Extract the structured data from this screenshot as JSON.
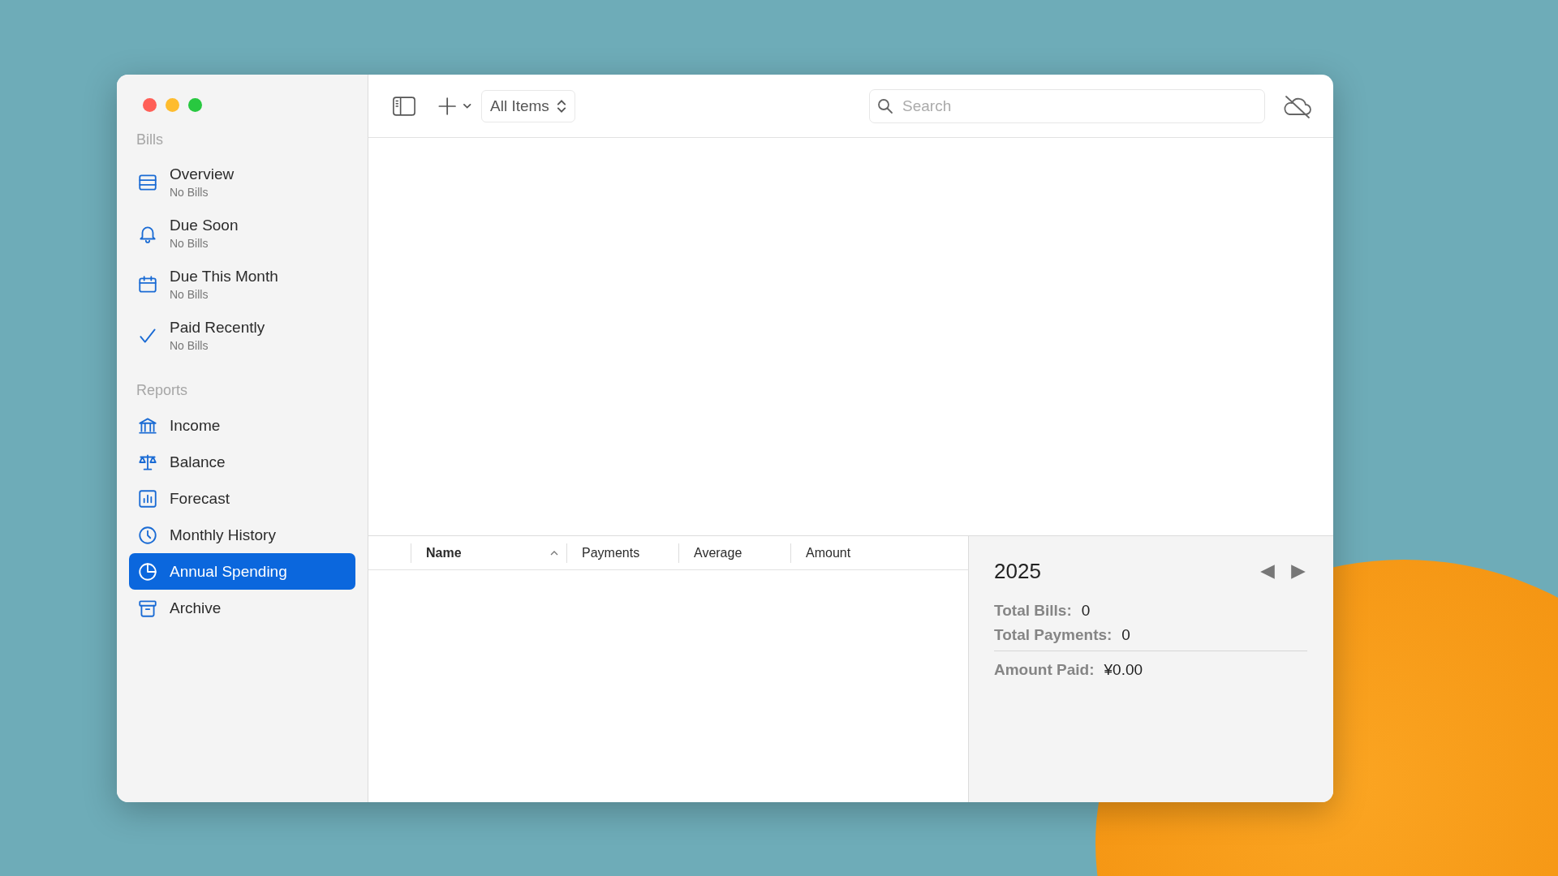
{
  "window": {
    "controls": [
      {
        "color": "#ff5f57"
      },
      {
        "color": "#febc2e"
      },
      {
        "color": "#28c840"
      }
    ]
  },
  "sidebar": {
    "sections": [
      {
        "title": "Bills",
        "items": [
          {
            "label": "Overview",
            "subtitle": "No Bills",
            "selected": false
          },
          {
            "label": "Due Soon",
            "subtitle": "No Bills",
            "selected": false
          },
          {
            "label": "Due This Month",
            "subtitle": "No Bills",
            "selected": false
          },
          {
            "label": "Paid Recently",
            "subtitle": "No Bills",
            "selected": false
          }
        ]
      },
      {
        "title": "Reports",
        "items": [
          {
            "label": "Income",
            "selected": false
          },
          {
            "label": "Balance",
            "selected": false
          },
          {
            "label": "Forecast",
            "selected": false
          },
          {
            "label": "Monthly History",
            "selected": false
          },
          {
            "label": "Annual Spending",
            "selected": true
          },
          {
            "label": "Archive",
            "selected": false
          }
        ]
      }
    ]
  },
  "toolbar": {
    "filter": "All Items",
    "search": {
      "placeholder": "Search"
    }
  },
  "table": {
    "columns": [
      {
        "label": "Name",
        "sorted": true
      },
      {
        "label": "Payments",
        "sorted": false
      },
      {
        "label": "Average",
        "sorted": false
      },
      {
        "label": "Amount",
        "sorted": false
      }
    ]
  },
  "summary": {
    "year": "2025",
    "stats": [
      {
        "kind": "count",
        "label": "Total Bills:",
        "value": "0"
      },
      {
        "kind": "count",
        "label": "Total Payments:",
        "value": "0"
      },
      {
        "kind": "total",
        "label": "Amount Paid:",
        "value": "¥0.00"
      }
    ]
  }
}
